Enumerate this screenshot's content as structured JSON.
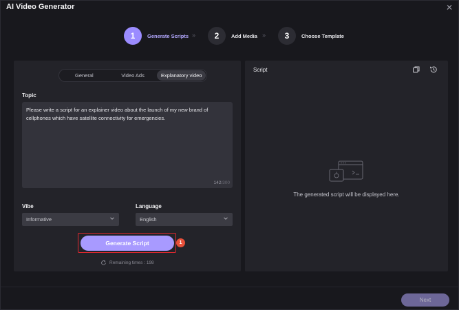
{
  "window": {
    "title": "AI Video Generator",
    "close_glyph": "✕"
  },
  "stepper": {
    "steps": [
      {
        "number": "1",
        "label": "Generate Scripts",
        "active": true
      },
      {
        "number": "2",
        "label": "Add Media",
        "active": false
      },
      {
        "number": "3",
        "label": "Choose Template",
        "active": false
      }
    ],
    "separator": "»"
  },
  "left": {
    "tabs": [
      {
        "label": "General",
        "selected": false
      },
      {
        "label": "Video Ads",
        "selected": false
      },
      {
        "label": "Explanatory video",
        "selected": true
      }
    ],
    "topic": {
      "label": "Topic",
      "value": "Please write a script for an explainer video about the launch of my new brand of cellphones which have satellite connectivity for emergencies.",
      "count": "142",
      "max": "/300"
    },
    "vibe": {
      "label": "Vibe",
      "value": "Informative"
    },
    "language": {
      "label": "Language",
      "value": "English"
    },
    "generate_button": "Generate Script",
    "badge": "1",
    "remaining": "Remaining times : 198"
  },
  "right": {
    "title": "Script",
    "placeholder": "The generated script will be displayed here."
  },
  "footer": {
    "next_label": "Next"
  },
  "colors": {
    "accent": "#9b8cff",
    "button": "#a89aff",
    "highlight": "#e0282f",
    "badge": "#e8503a"
  }
}
